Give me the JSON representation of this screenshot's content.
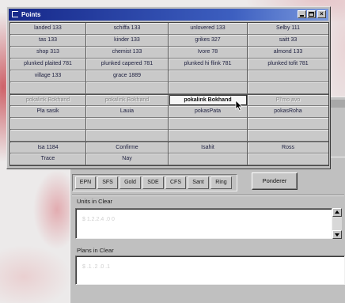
{
  "points_window": {
    "title": "Points",
    "title_icon": "window-icon",
    "controls": [
      "minimize-icon",
      "maximize-icon",
      "close-icon"
    ],
    "rows": [
      [
        "landed 133",
        "schiffa 133",
        "unlovered 133",
        "Selby 111"
      ],
      [
        "tas 133",
        "kinder 133",
        "grikes 327",
        "saitt 33"
      ],
      [
        "shop 313",
        "chemist 133",
        "Ivore 78",
        "almond 133"
      ],
      [
        "plunked plaited 781",
        "plunked capered 781",
        "plunked hi flink 781",
        "plunked tofit 781"
      ],
      [
        "village 133",
        "grace 1889"
      ],
      [
        "pokalink Bokhand",
        "pokalink Bokhand",
        "pokalink Bokhand",
        "Pl'mo avo"
      ],
      [
        "Pla sasik",
        "Lauia",
        "pokasPata",
        "pokasRoha"
      ],
      [
        "Isa 1184",
        "Confirme",
        "Isahit",
        "Ross"
      ],
      [
        "Trace",
        "Nay"
      ]
    ]
  },
  "editor_window": {
    "tabs": [
      "EPN",
      "SFS",
      "Gold",
      "SDE",
      "CFS",
      "Sant",
      "Ring"
    ],
    "action_button": "Ponderer",
    "fields": [
      {
        "label": "Units in Clear",
        "value": "$ 1.2.2.4 .0 0"
      },
      {
        "label": "Plans in Clear",
        "value": "$ .1 .2 .0 .1"
      }
    ],
    "scroll_icons": [
      "scroll-up-icon",
      "scroll-down-icon"
    ]
  },
  "colors": {
    "titlebar": "#16288a",
    "window": "#c0c0c0",
    "selected_cell": "#f6f6f6",
    "wallpaper_accent": "#c4343e"
  }
}
